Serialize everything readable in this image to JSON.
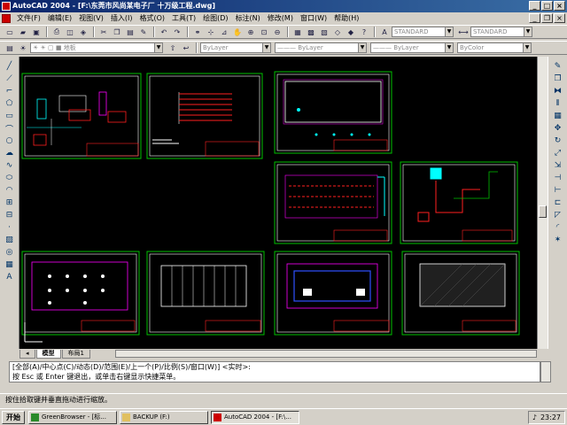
{
  "window": {
    "title": "AutoCAD 2004 - [F:\\东莞市风尚某电子厂 十万级工程.dwg]",
    "minimize": "_",
    "maximize": "□",
    "close": "×"
  },
  "menu": [
    "文件(F)",
    "编辑(E)",
    "视图(V)",
    "插入(I)",
    "格式(O)",
    "工具(T)",
    "绘图(D)",
    "标注(N)",
    "修改(M)",
    "窗口(W)",
    "帮助(H)"
  ],
  "toolbars": {
    "text_style": "STANDARD",
    "dim_style": "STANDARD",
    "layer": "地板",
    "color": "ByLayer",
    "linetype": "ByLayer",
    "lineweight": "ByLayer",
    "plotstyle": "ByColor"
  },
  "tabs": {
    "model": "模型",
    "layout": "布局1"
  },
  "command": {
    "line1": "[全部(A)/中心点(C)/动态(D)/范围(E)/上一个(P)/比例(S)/窗口(W)] <实时>:",
    "line2": "按 Esc 或 Enter 键退出，或单击右键显示快捷菜单。"
  },
  "status": "按住拾取键并垂直拖动进行缩放。",
  "taskbar": {
    "start": "开始",
    "items": [
      {
        "label": "GreenBrowser - [标..."
      },
      {
        "label": "BACKUP (F:)"
      },
      {
        "label": "AutoCAD 2004 - [F:\\..."
      }
    ],
    "clock": "23:27"
  },
  "colors": {
    "canvas": "#000000",
    "border_green": "#00c000",
    "cad_white": "#ffffff",
    "cad_red": "#ff2020",
    "cad_cyan": "#00ffff",
    "cad_magenta": "#ff00ff",
    "cad_yellow": "#ffff00"
  }
}
